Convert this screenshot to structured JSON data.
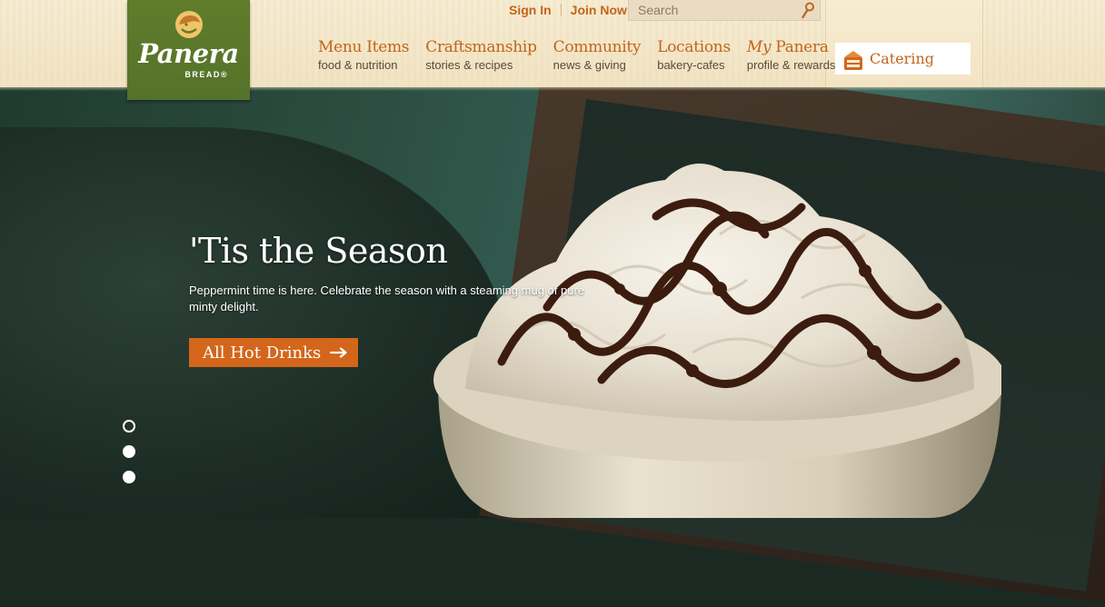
{
  "brand": {
    "name": "Panera",
    "subname": "BREAD®",
    "colors": {
      "logo_green": "#5f7d2b",
      "accent_orange": "#c2651a",
      "cta_orange": "#d3661a"
    }
  },
  "account": {
    "sign_in": "Sign In",
    "join_now": "Join Now"
  },
  "search": {
    "placeholder": "Search",
    "icon": "search-icon"
  },
  "nav": [
    {
      "title": "Menu Items",
      "sub": "food & nutrition"
    },
    {
      "title": "Craftsmanship",
      "sub": "stories & recipes"
    },
    {
      "title": "Community",
      "sub": "news & giving"
    },
    {
      "title": "Locations",
      "sub": "bakery-cafes"
    },
    {
      "title_prefix": "My",
      "title": "Panera",
      "sub": "profile & rewards"
    }
  ],
  "catering": {
    "label": "Catering",
    "icon": "catering-box-icon"
  },
  "hero": {
    "title": "'Tis the Season",
    "description": "Peppermint time is here. Celebrate the season with a steaming mug of pure minty delight.",
    "cta_label": "All Hot Drinks",
    "cta_icon": "arrow-right-icon"
  },
  "slider": {
    "count": 3,
    "active_index": 0
  }
}
